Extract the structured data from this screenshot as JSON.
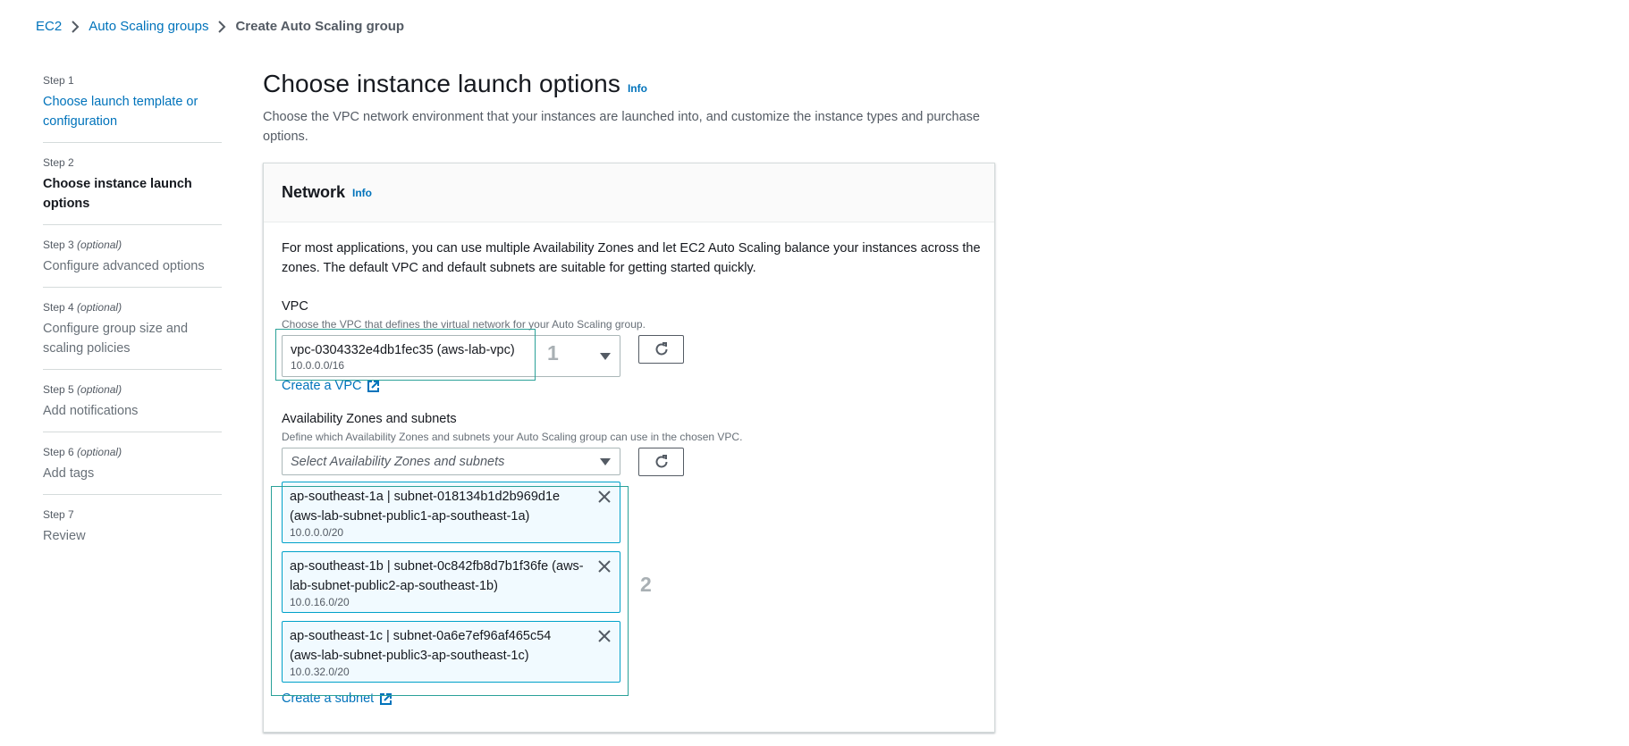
{
  "breadcrumb": {
    "items": [
      "EC2",
      "Auto Scaling groups"
    ],
    "current": "Create Auto Scaling group"
  },
  "steps": [
    {
      "num": "Step 1",
      "optional": "",
      "title": "Choose launch template or configuration",
      "state": "link"
    },
    {
      "num": "Step 2",
      "optional": "",
      "title": "Choose instance launch options",
      "state": "active"
    },
    {
      "num": "Step 3",
      "optional": "(optional)",
      "title": "Configure advanced options",
      "state": "disabled"
    },
    {
      "num": "Step 4",
      "optional": "(optional)",
      "title": "Configure group size and scaling policies",
      "state": "disabled"
    },
    {
      "num": "Step 5",
      "optional": "(optional)",
      "title": "Add notifications",
      "state": "disabled"
    },
    {
      "num": "Step 6",
      "optional": "(optional)",
      "title": "Add tags",
      "state": "disabled"
    },
    {
      "num": "Step 7",
      "optional": "",
      "title": "Review",
      "state": "disabled"
    }
  ],
  "page": {
    "title": "Choose instance launch options",
    "info": "Info",
    "description": "Choose the VPC network environment that your instances are launched into, and customize the instance types and purchase options."
  },
  "network": {
    "title": "Network",
    "info": "Info",
    "description": "For most applications, you can use multiple Availability Zones and let EC2 Auto Scaling balance your instances across the zones. The default VPC and default subnets are suitable for getting started quickly.",
    "vpc": {
      "label": "VPC",
      "help": "Choose the VPC that defines the virtual network for your Auto Scaling group.",
      "value": "vpc-0304332e4db1fec35 (aws-lab-vpc)",
      "cidr": "10.0.0.0/16",
      "create_link": "Create a VPC"
    },
    "az": {
      "label": "Availability Zones and subnets",
      "help": "Define which Availability Zones and subnets your Auto Scaling group can use in the chosen VPC.",
      "placeholder": "Select Availability Zones and subnets",
      "subnets": [
        {
          "label": "ap-southeast-1a | subnet-018134b1d2b969d1e (aws-lab-subnet-public1-ap-southeast-1a)",
          "cidr": "10.0.0.0/20"
        },
        {
          "label": "ap-southeast-1b | subnet-0c842fb8d7b1f36fe (aws-lab-subnet-public2-ap-southeast-1b)",
          "cidr": "10.0.16.0/20"
        },
        {
          "label": "ap-southeast-1c | subnet-0a6e7ef96af465c54 (aws-lab-subnet-public3-ap-southeast-1c)",
          "cidr": "10.0.32.0/20"
        }
      ],
      "create_link": "Create a subnet"
    }
  },
  "annotations": [
    "1",
    "2"
  ],
  "colors": {
    "link": "#0073bb",
    "annotation_border": "#2aa198",
    "token_border": "#00a1c9",
    "token_bg": "#f1faff"
  }
}
